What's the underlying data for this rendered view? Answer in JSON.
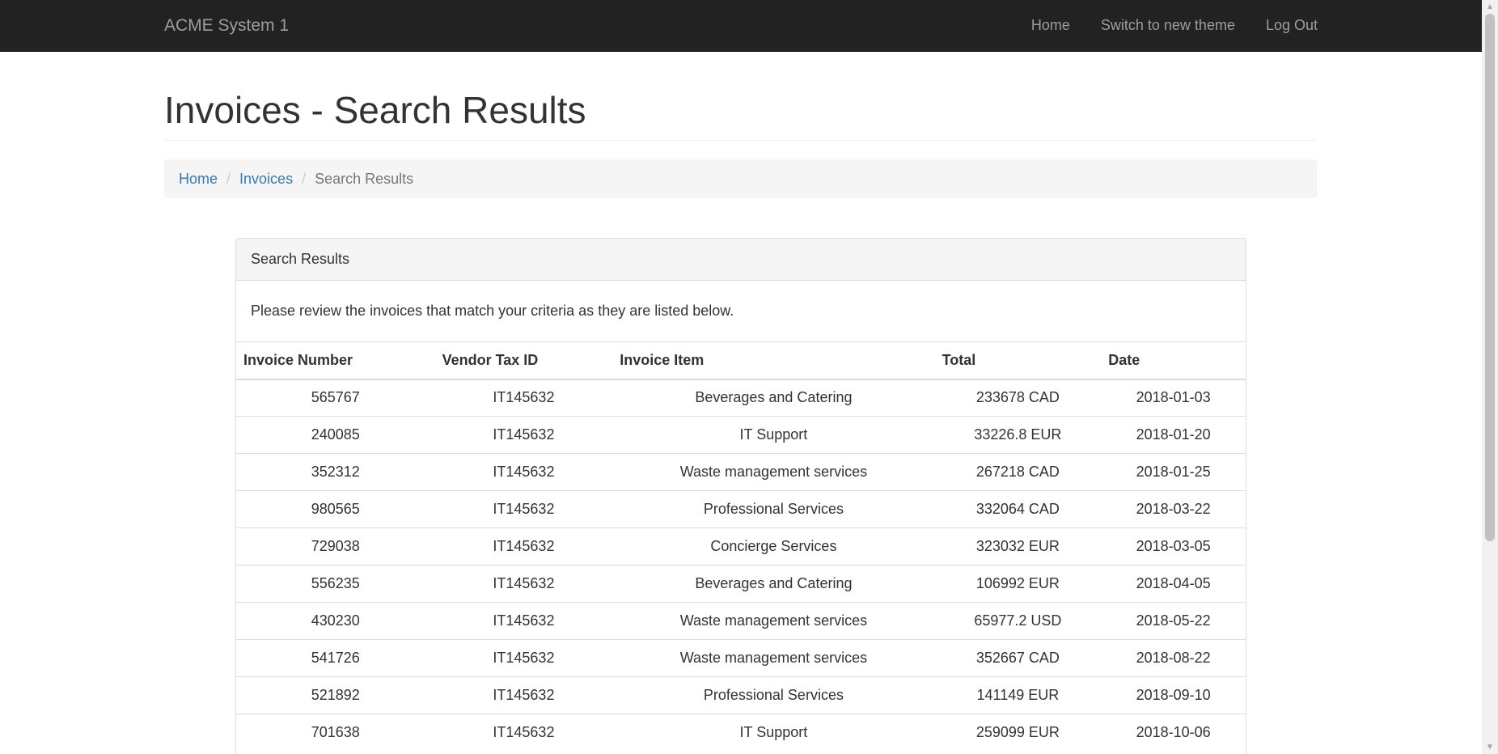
{
  "navbar": {
    "brand": "ACME System 1",
    "links": [
      "Home",
      "Switch to new theme",
      "Log Out"
    ]
  },
  "page": {
    "title": "Invoices - Search Results"
  },
  "breadcrumb": {
    "items": [
      "Home",
      "Invoices"
    ],
    "active": "Search Results",
    "separator": "/"
  },
  "panel": {
    "heading": "Search Results",
    "body": "Please review the invoices that match your criteria as they are listed below."
  },
  "table": {
    "headers": [
      "Invoice Number",
      "Vendor Tax ID",
      "Invoice Item",
      "Total",
      "Date"
    ],
    "rows": [
      [
        "565767",
        "IT145632",
        "Beverages and Catering",
        "233678 CAD",
        "2018-01-03"
      ],
      [
        "240085",
        "IT145632",
        "IT Support",
        "33226.8 EUR",
        "2018-01-20"
      ],
      [
        "352312",
        "IT145632",
        "Waste management services",
        "267218 CAD",
        "2018-01-25"
      ],
      [
        "980565",
        "IT145632",
        "Professional Services",
        "332064 CAD",
        "2018-03-22"
      ],
      [
        "729038",
        "IT145632",
        "Concierge Services",
        "323032 EUR",
        "2018-03-05"
      ],
      [
        "556235",
        "IT145632",
        "Beverages and Catering",
        "106992 EUR",
        "2018-04-05"
      ],
      [
        "430230",
        "IT145632",
        "Waste management services",
        "65977.2 USD",
        "2018-05-22"
      ],
      [
        "541726",
        "IT145632",
        "Waste management services",
        "352667 CAD",
        "2018-08-22"
      ],
      [
        "521892",
        "IT145632",
        "Professional Services",
        "141149 EUR",
        "2018-09-10"
      ],
      [
        "701638",
        "IT145632",
        "IT Support",
        "259099 EUR",
        "2018-10-06"
      ]
    ]
  },
  "scrollbar": {
    "up_icon": "triangle-up-icon",
    "down_icon": "triangle-down-icon"
  }
}
